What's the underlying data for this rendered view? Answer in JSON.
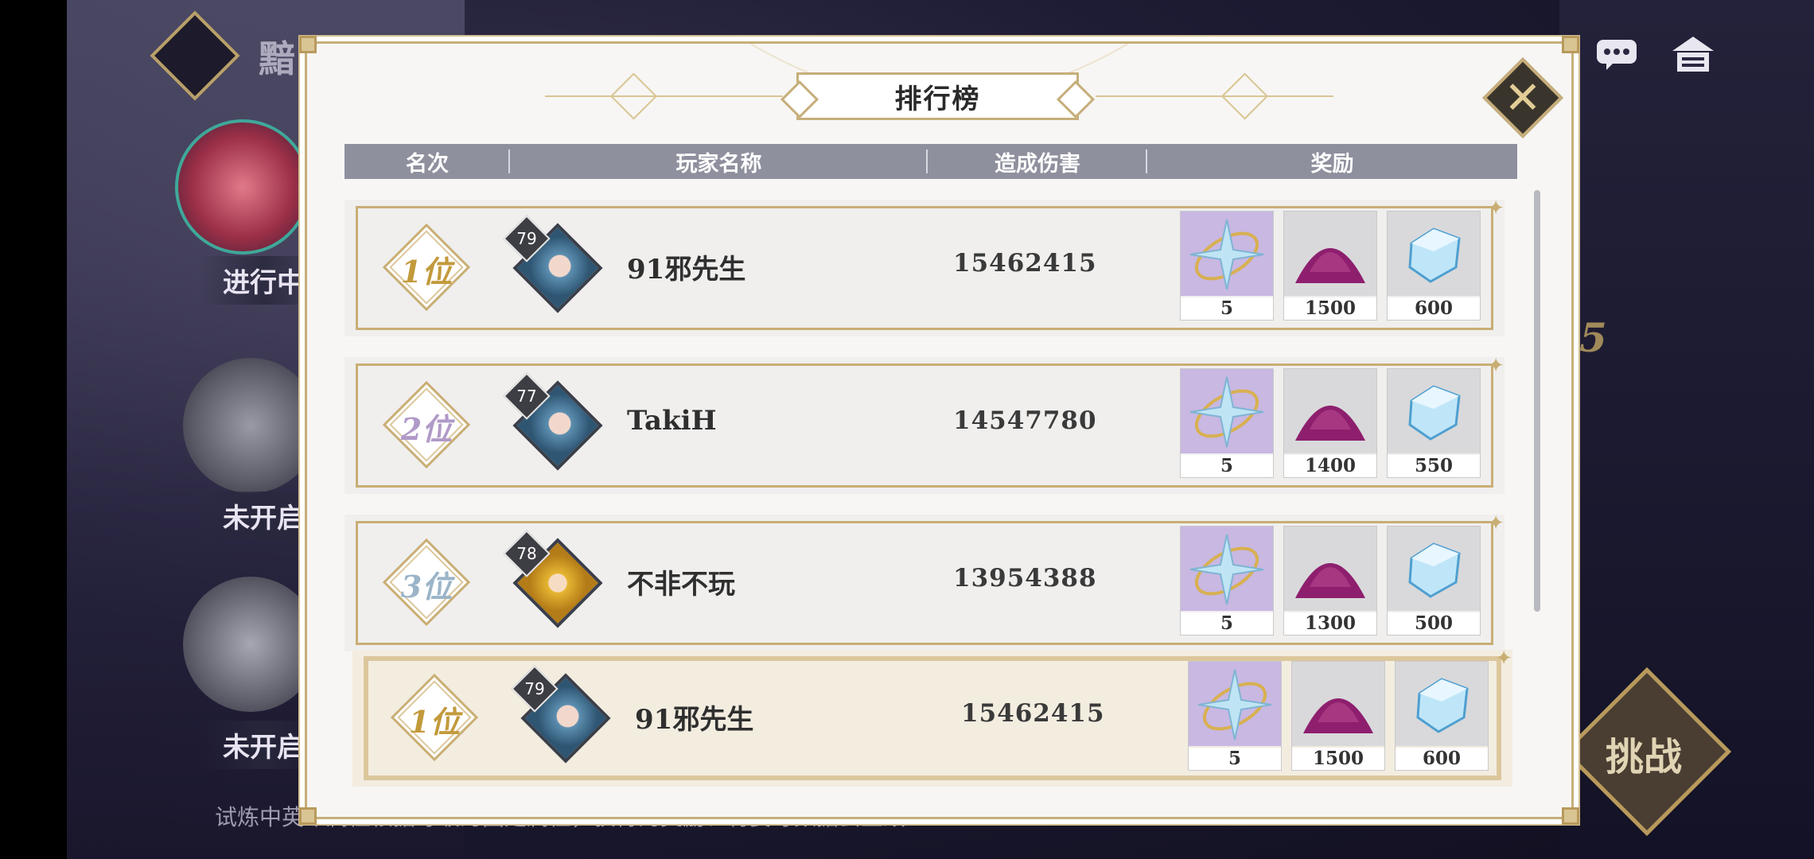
{
  "background": {
    "top_title": "黯",
    "side_tags": [
      "进行中",
      "未开启",
      "未开启"
    ],
    "bottom_hint": "试炼中英雄属性根据等级为固定属性，获得的奖励、将要等数据会生效",
    "challenge_label": "挑战",
    "right_number": "5"
  },
  "modal": {
    "title": "排行榜",
    "close_icon": "close-x-icon",
    "columns": [
      "名次",
      "玩家名称",
      "造成伤害",
      "奖励"
    ],
    "rows": [
      {
        "rank": "1位",
        "rank_color": "#c29a3c",
        "level": "79",
        "avatar": "blue-hair-girl",
        "name": "91邪先生",
        "damage": "15462415",
        "rewards": [
          "5",
          "1500",
          "600"
        ]
      },
      {
        "rank": "2位",
        "rank_color": "#b09ac8",
        "level": "77",
        "avatar": "blue-hair-girl",
        "name": "TakiH",
        "damage": "14547780",
        "rewards": [
          "5",
          "1400",
          "550"
        ]
      },
      {
        "rank": "3位",
        "rank_color": "#9bb4c8",
        "level": "78",
        "avatar": "blond-boy",
        "name": "不非不玩",
        "damage": "13954388",
        "rewards": [
          "5",
          "1300",
          "500"
        ]
      }
    ],
    "self_row": {
      "rank": "1位",
      "level": "79",
      "avatar": "blue-hair-girl",
      "name": "91邪先生",
      "damage": "15462415",
      "rewards": [
        "5",
        "1500",
        "600"
      ]
    },
    "reward_icons": [
      "star-compass-icon",
      "purple-dust-pile-icon",
      "crystal-gem-icon"
    ]
  }
}
